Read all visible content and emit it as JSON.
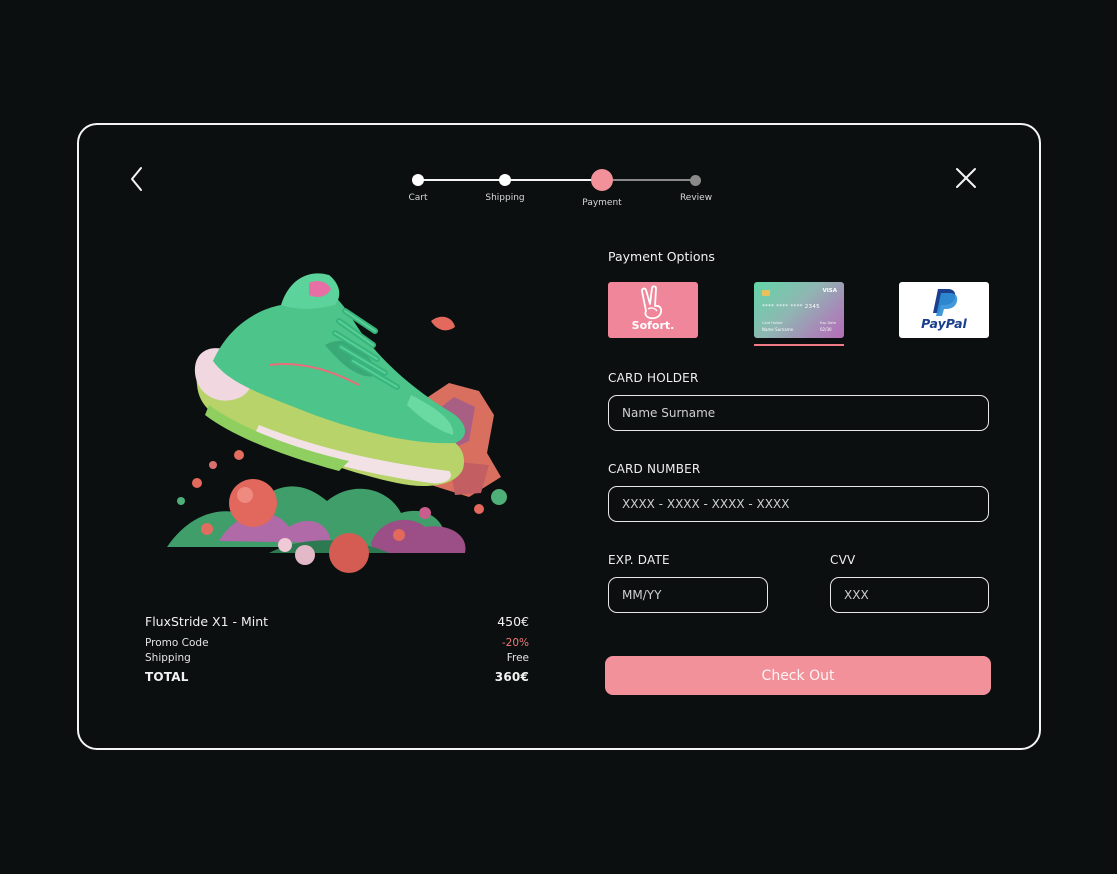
{
  "colors": {
    "background": "#0b0f0f",
    "accent": "#f3919b",
    "discount": "#f07a7a"
  },
  "nav": {
    "back_icon": "chevron-left-icon",
    "close_icon": "close-icon"
  },
  "stepper": {
    "steps": [
      {
        "label": "Cart",
        "state": "done"
      },
      {
        "label": "Shipping",
        "state": "done"
      },
      {
        "label": "Payment",
        "state": "active"
      },
      {
        "label": "Review",
        "state": "pending"
      }
    ]
  },
  "summary": {
    "product_name": "FluxStride X1 - Mint",
    "product_price": "450€",
    "promo_label": "Promo Code",
    "promo_value": "-20%",
    "shipping_label": "Shipping",
    "shipping_value": "Free",
    "total_label": "TOTAL",
    "total_value": "360€"
  },
  "payment": {
    "title": "Payment Options",
    "options": [
      {
        "name": "Sofort.",
        "selected": false
      },
      {
        "name": "card",
        "selected": true,
        "brand": "VISA",
        "number_hint": "**** **** **** 2345",
        "holder_caption": "Card Holder",
        "holder_name": "Name Surname",
        "exp_caption": "Exp Date",
        "exp_value": "02/30"
      },
      {
        "name": "PayPal",
        "selected": false
      }
    ],
    "card_holder": {
      "label": "CARD HOLDER",
      "placeholder": "Name Surname"
    },
    "card_number": {
      "label": "CARD NUMBER",
      "placeholder": "XXXX - XXXX - XXXX - XXXX"
    },
    "exp_date": {
      "label": "EXP. DATE",
      "placeholder": "MM/YY"
    },
    "cvv": {
      "label": "CVV",
      "placeholder": "XXX"
    },
    "checkout_label": "Check Out"
  }
}
